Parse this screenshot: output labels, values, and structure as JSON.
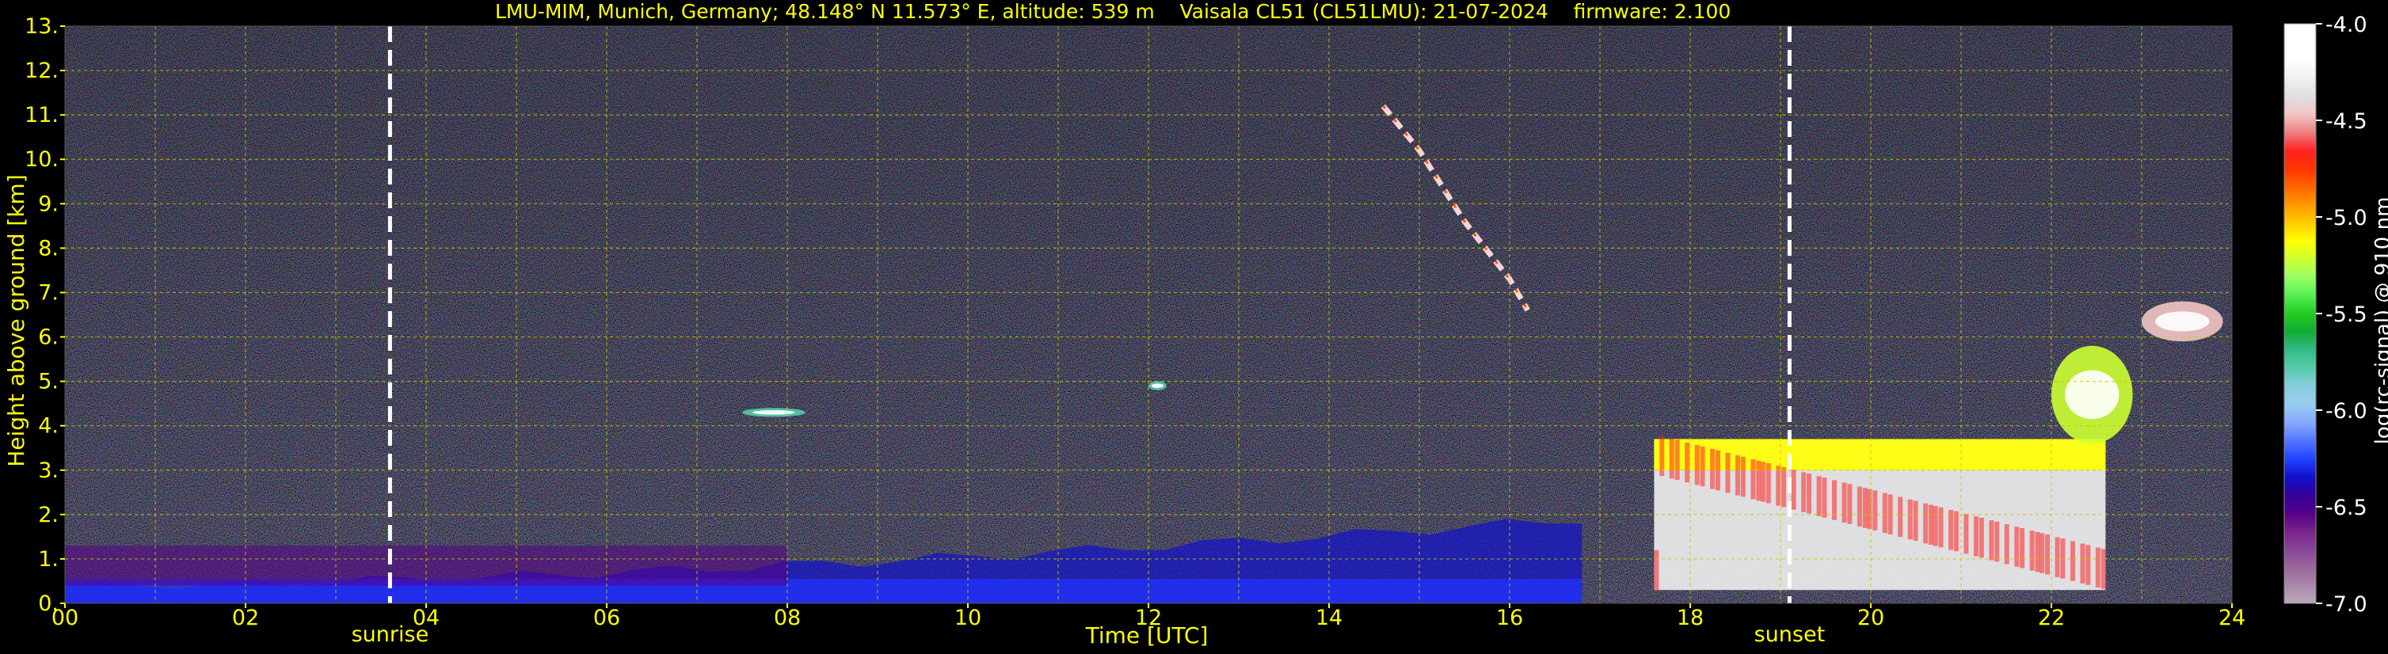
{
  "title": {
    "station": "LMU-MIM, Munich, Germany; 48.148° N 11.573° E, altitude: 539 m",
    "instrument": "Vaisala CL51 (CL51LMU): 21-07-2024",
    "firmware": "firmware: 2.100"
  },
  "colors": {
    "background": "#000000",
    "text": "#ffff00",
    "grid": "#c8c800",
    "event_line": "#ffffff",
    "colorbar_text": "#ffffff"
  },
  "chart_data": {
    "type": "heatmap",
    "title": "LMU-MIM, Munich, Germany; 48.148° N 11.573° E, altitude: 539 m    Vaisala CL51 (CL51LMU): 21-07-2024    firmware: 2.100",
    "xlabel": "Time [UTC]",
    "ylabel": "Height above ground [km]",
    "x_unit": "hour UTC",
    "y_unit": "km",
    "xlim": [
      0,
      24
    ],
    "ylim": [
      0,
      13
    ],
    "x_ticks": [
      "00",
      "02",
      "04",
      "06",
      "08",
      "10",
      "12",
      "14",
      "16",
      "18",
      "20",
      "22",
      "24"
    ],
    "y_ticks": [
      "0.",
      "1.",
      "2.",
      "3.",
      "4.",
      "5.",
      "6.",
      "7.",
      "8.",
      "9.",
      "10.",
      "11.",
      "12.",
      "13."
    ],
    "grid": true,
    "events": [
      {
        "label": "sunrise",
        "time": 3.6
      },
      {
        "label": "sunset",
        "time": 19.1
      }
    ],
    "colorbar": {
      "label": "log(rc-signal) @ 910 nm",
      "min": -7.0,
      "max": -4.0,
      "ticks": [
        "-4.0",
        "-4.5",
        "-5.0",
        "-5.5",
        "-6.0",
        "-6.5",
        "-7.0"
      ],
      "colors": [
        "#ffffff",
        "#ffffff",
        "#ffffff",
        "#f0f0f0",
        "#e0e0e0",
        "#f2c4c4",
        "#f08080",
        "#ff2222",
        "#ff3300",
        "#ff6600",
        "#ff9900",
        "#ffcc00",
        "#ffff00",
        "#ccff33",
        "#99ff66",
        "#55ee55",
        "#22cc22",
        "#11aa33",
        "#33bb88",
        "#55ccaa",
        "#88ccdd",
        "#99ccee",
        "#88aaff",
        "#5577ff",
        "#2244ff",
        "#1111cc",
        "#330099",
        "#550088",
        "#772288",
        "#884499",
        "#996699",
        "#aa88aa",
        "#bbaabb"
      ]
    },
    "layers": [
      {
        "name": "aerosol boundary layer",
        "t_start": 0.0,
        "t_end": 16.8,
        "top_km_start": 0.4,
        "top_km_end": 1.9,
        "log_signal": -6.3
      },
      {
        "name": "residual layer",
        "t_start": 0.0,
        "t_end": 8.0,
        "bottom_km": 0.4,
        "top_km": 1.3,
        "log_signal": -6.55
      },
      {
        "name": "low cloud",
        "t_start": 17.6,
        "t_end": 22.6,
        "bottom_km": 0.3,
        "top_km": 3.7,
        "log_signal": -4.3
      },
      {
        "name": "cloud top band",
        "t_start": 17.6,
        "t_end": 22.6,
        "bottom_km": 3.0,
        "top_km": 3.7,
        "log_signal": -5.1
      }
    ],
    "features": [
      {
        "name": "cirrus fall streak",
        "points": [
          [
            14.6,
            11.2
          ],
          [
            15.0,
            10.2
          ],
          [
            15.5,
            8.6
          ],
          [
            16.0,
            7.3
          ],
          [
            16.2,
            6.6
          ]
        ],
        "log_signal": -4.6
      },
      {
        "name": "elevated cloud",
        "t_start": 23.0,
        "t_end": 23.9,
        "bottom_km": 5.9,
        "top_km": 6.8,
        "log_signal": -4.5
      },
      {
        "name": "aerosol patch",
        "t_start": 7.5,
        "t_end": 8.2,
        "bottom_km": 4.2,
        "top_km": 4.4,
        "log_signal": -5.8
      },
      {
        "name": "cloud fragment",
        "t_start": 12.0,
        "t_end": 12.2,
        "bottom_km": 4.8,
        "top_km": 5.0,
        "log_signal": -5.8
      },
      {
        "name": "rising cloud",
        "t_start": 22.0,
        "t_end": 22.9,
        "bottom_km": 3.6,
        "top_km": 5.8,
        "log_signal": -5.2
      }
    ]
  }
}
